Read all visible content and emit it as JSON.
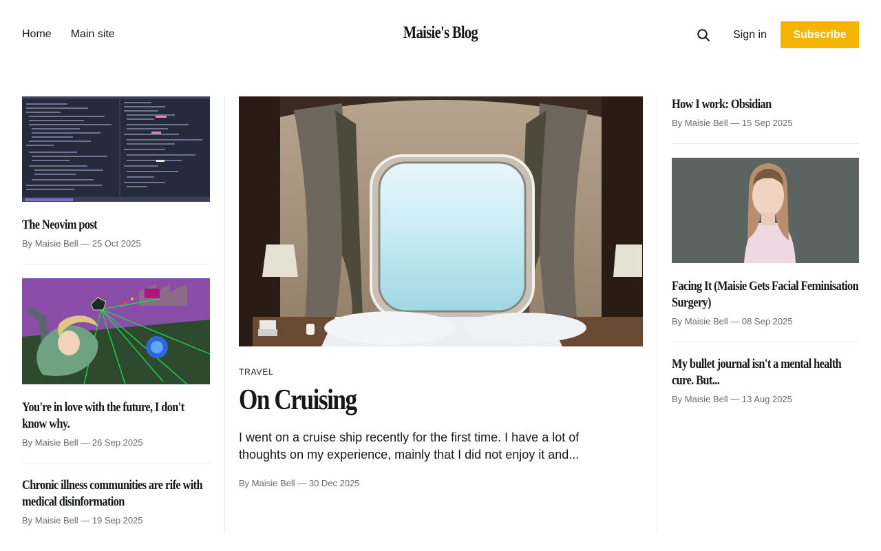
{
  "nav": {
    "home": "Home",
    "main_site": "Main site"
  },
  "site_title": "Maisie's Blog",
  "header": {
    "sign_in": "Sign in",
    "subscribe": "Subscribe"
  },
  "left_posts": [
    {
      "title": "The Neovim post",
      "meta": "By Maisie Bell — 25 Oct 2025"
    },
    {
      "title": "You're in love with the future, I don't know why.",
      "meta": "By Maisie Bell — 26 Sep 2025"
    },
    {
      "title": "Chronic illness communities are rife with medical disinformation",
      "meta": "By Maisie Bell — 19 Sep 2025"
    }
  ],
  "featured": {
    "tag": "TRAVEL",
    "title": "On Cruising",
    "excerpt": "I went on a cruise ship recently for the first time. I have a lot of thoughts on my experience, mainly that I did not enjoy it and...",
    "meta": "By Maisie Bell — 30 Dec 2025"
  },
  "right_posts": [
    {
      "title": "How I work: Obsidian",
      "meta": "By Maisie Bell — 15 Sep 2025"
    },
    {
      "title": "Facing It (Maisie Gets Facial Feminisation Surgery)",
      "meta": "By Maisie Bell — 08 Sep 2025"
    },
    {
      "title": "My bullet journal isn't a mental health cure. But...",
      "meta": "By Maisie Bell — 13 Aug 2025"
    }
  ],
  "colors": {
    "accent": "#f4b400",
    "text": "#15171a",
    "meta": "#666a70"
  }
}
